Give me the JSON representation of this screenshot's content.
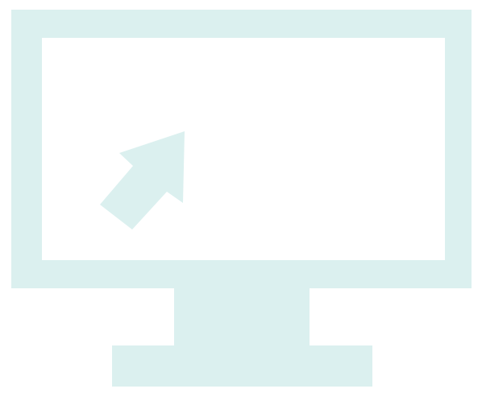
{
  "icon": {
    "name": "computer-monitor-icon",
    "pointer": "cursor-arrow-icon",
    "color": "#dbf0ef",
    "background": "#ffffff"
  }
}
